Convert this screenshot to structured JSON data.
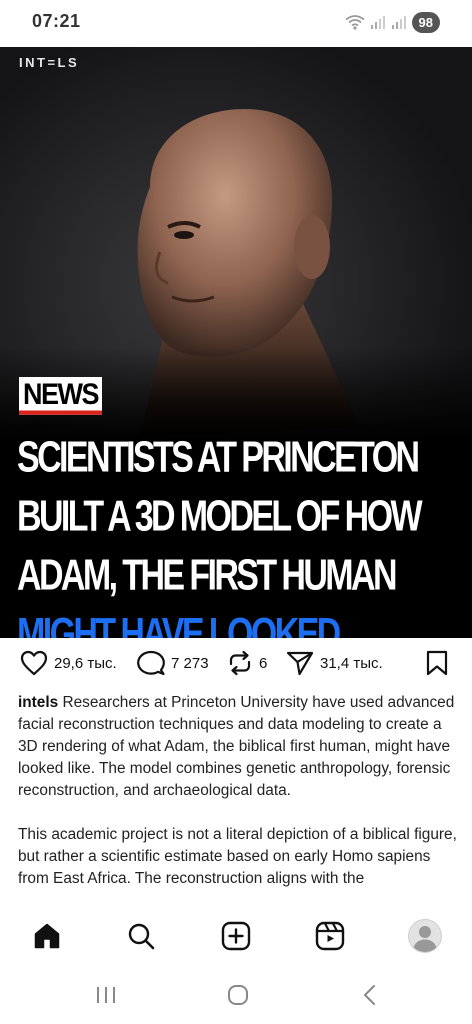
{
  "status": {
    "time": "07:21",
    "battery": "98",
    "icons": [
      "wifi-icon",
      "signal-icon",
      "signal-icon"
    ]
  },
  "post": {
    "brand": "INT=LS",
    "tag": "NEWS",
    "headline_lines": [
      "SCIENTISTS AT PRINCETON",
      "BUILT A 3D MODEL OF HOW",
      "ADAM, THE FIRST HUMAN"
    ],
    "headline_highlight": "MIGHT HAVE LOOKED",
    "colors": {
      "highlight": "#1c6ef2",
      "tag_underline": "#d9241c"
    }
  },
  "actions": {
    "likes": "29,6 тыс.",
    "comments": "7 273",
    "reposts": "6",
    "shares": "31,4 тыс.",
    "icons": [
      "heart-icon",
      "comment-icon",
      "repost-icon",
      "send-icon",
      "bookmark-icon"
    ]
  },
  "caption": {
    "username": "intels",
    "paragraph1": "Researchers at Princeton University have used advanced facial reconstruction techniques and data modeling to create a 3D rendering of what Adam, the biblical first human, might have looked like. The model combines genetic anthropology, forensic reconstruction, and archaeological data.",
    "paragraph2": "This academic project is not a literal depiction of a biblical figure, but rather a scientific estimate based on early Homo sapiens from East Africa. The reconstruction aligns with the"
  },
  "bottom_nav": [
    "home-icon",
    "search-icon",
    "create-icon",
    "reels-icon",
    "profile-avatar"
  ],
  "system_nav": [
    "recent-apps-icon",
    "home-circle-icon",
    "back-icon"
  ]
}
